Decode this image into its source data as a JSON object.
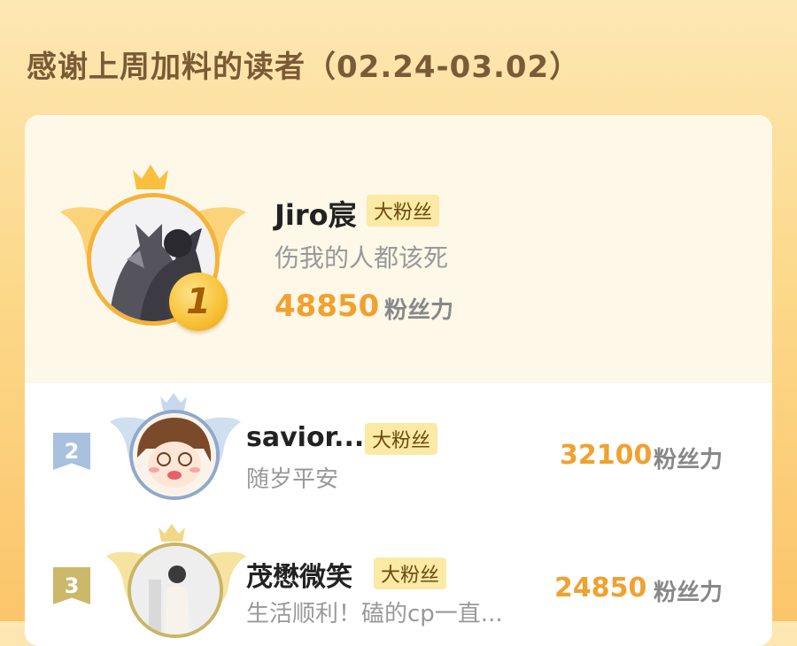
{
  "page": {
    "title": "感谢上周加料的读者（02.24-03.02）"
  },
  "leaderboard": [
    {
      "rank": "1",
      "name": "Jiro宸",
      "badge": "大粉丝",
      "motto": "伤我的人都该死",
      "score": "48850",
      "score_unit": "粉丝力"
    },
    {
      "rank": "2",
      "name": "savior...",
      "badge": "大粉丝",
      "motto": "随岁平安",
      "score": "32100",
      "score_unit": "粉丝力"
    },
    {
      "rank": "3",
      "name": "茂懋微笑",
      "badge": "大粉丝",
      "motto": "生活顺利！磕的cp一直...",
      "score": "24850",
      "score_unit": "粉丝力"
    }
  ],
  "colors": {
    "accent": "#f0a12f",
    "gold": "#f5b33a",
    "silver": "#9fb6d6",
    "bronze": "#c9b567",
    "background_top": "#fde7b3",
    "background_bottom": "#fbc56a"
  },
  "icons": [
    "crown-icon",
    "wing-icon",
    "rank-medal-icon",
    "rank-flag-icon"
  ]
}
